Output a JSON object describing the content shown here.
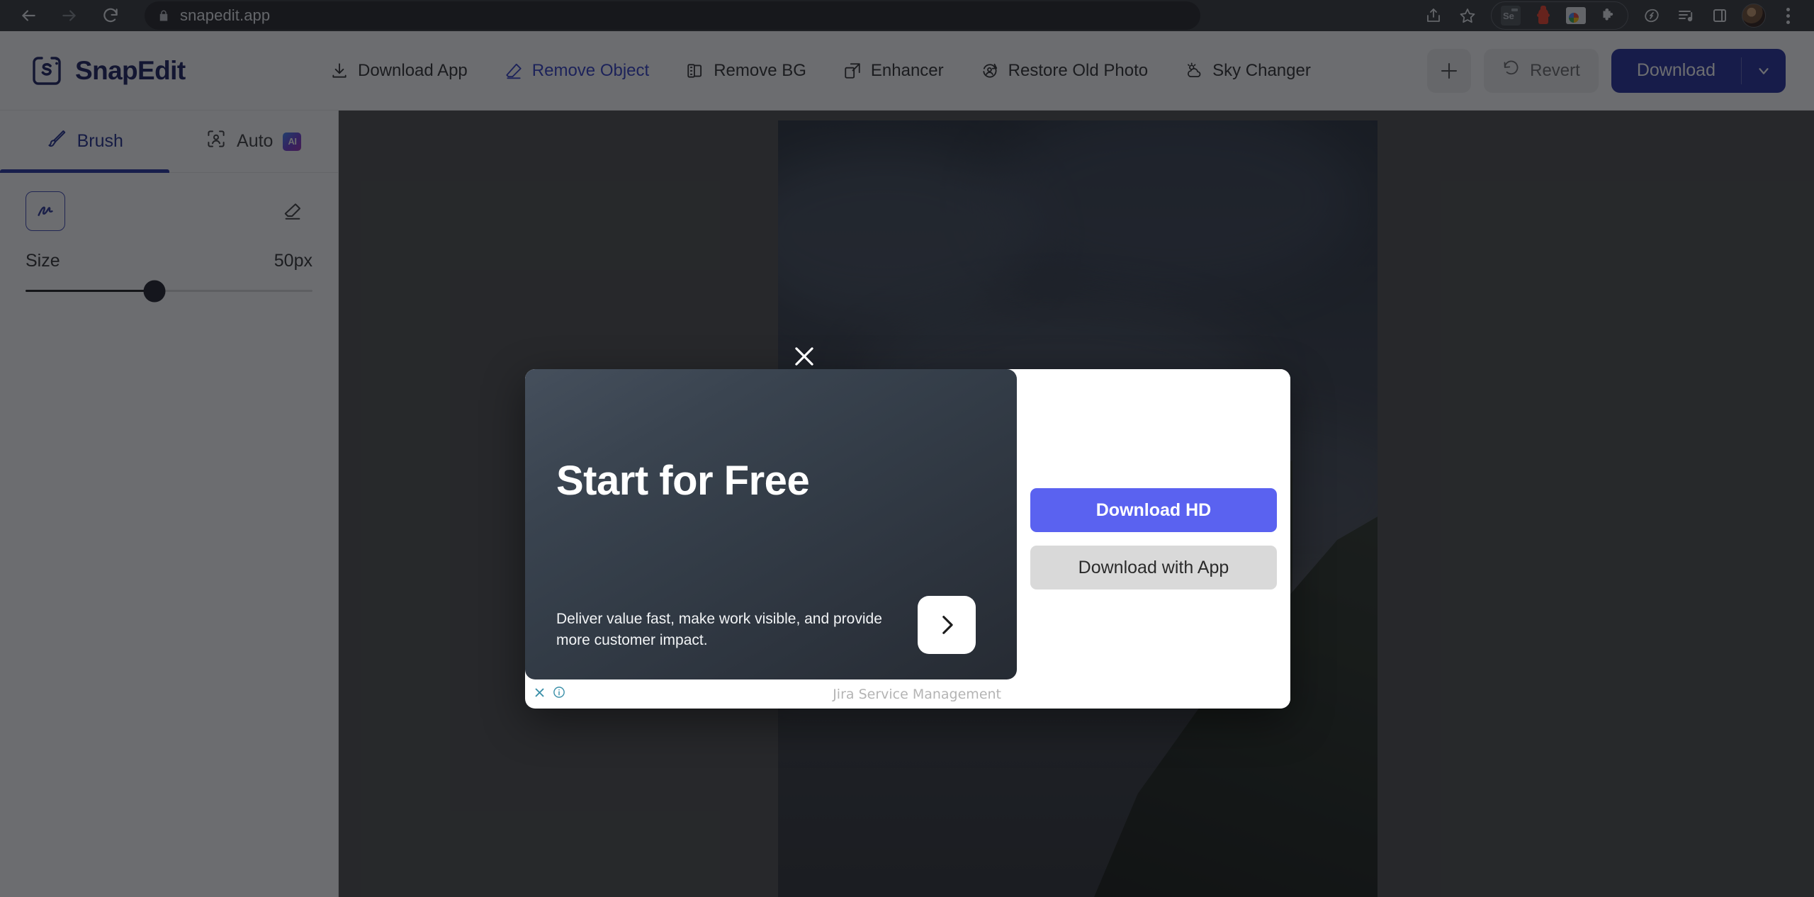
{
  "browser": {
    "url": "snapedit.app",
    "back_label": "Back",
    "forward_label": "Forward",
    "reload_label": "Reload",
    "share_label": "Share",
    "bookmark_label": "Bookmark",
    "extensions": [
      "Se",
      "hydrant-extension",
      "photos-extension",
      "puzzle-extension"
    ],
    "menu_label": "Customize and control"
  },
  "app": {
    "logo_text": "SnapEdit",
    "nav": [
      {
        "label": "Download App",
        "icon": "download-icon",
        "active": false
      },
      {
        "label": "Remove Object",
        "icon": "eraser-icon",
        "active": true
      },
      {
        "label": "Remove BG",
        "icon": "layers-icon",
        "active": false
      },
      {
        "label": "Enhancer",
        "icon": "enhance-icon",
        "active": false
      },
      {
        "label": "Restore Old Photo",
        "icon": "restore-icon",
        "active": false
      },
      {
        "label": "Sky Changer",
        "icon": "cloud-sun-icon",
        "active": false
      }
    ],
    "actions": {
      "add_label": "+",
      "revert_label": "Revert",
      "download_label": "Download",
      "download_caret_label": "▾"
    }
  },
  "sidebar": {
    "tabs": [
      {
        "label": "Brush",
        "icon": "brush-icon",
        "active": true,
        "badge": ""
      },
      {
        "label": "Auto",
        "icon": "auto-select-icon",
        "active": false,
        "badge": "AI"
      }
    ],
    "tools": [
      {
        "name": "brush-tool",
        "selected": true
      },
      {
        "name": "eraser-tool",
        "selected": false
      }
    ],
    "size": {
      "label": "Size",
      "value": "50px",
      "percent": 45
    }
  },
  "modal": {
    "close_label": "✕",
    "ad": {
      "title": "Start for Free",
      "description": "Deliver value fast, make work visible, and provide more customer impact.",
      "cta_label": "›",
      "brand": "Jira Service Management",
      "adchoices_close": "✕",
      "adchoices_info": "i"
    },
    "buttons": {
      "download_hd": "Download HD",
      "download_with_app": "Download with App"
    }
  },
  "colors": {
    "brand_navy": "#161c5e",
    "accent_blue": "#2f3cc4",
    "download_btn": "#212a9b",
    "modal_primary": "#5a62f0",
    "chrome_bg": "#323639",
    "canvas_bg": "#4a4a4a"
  }
}
